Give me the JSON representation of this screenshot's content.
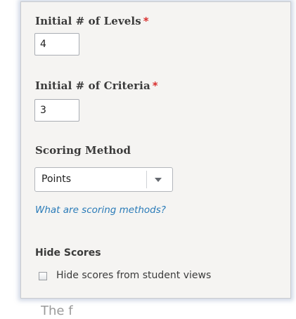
{
  "form": {
    "levels": {
      "label": "Initial # of Levels",
      "required_mark": "*",
      "value": "4"
    },
    "criteria": {
      "label": "Initial # of Criteria",
      "required_mark": "*",
      "value": "3"
    },
    "scoring": {
      "label": "Scoring Method",
      "selected": "Points",
      "help_link": "What are scoring methods?"
    },
    "hide_scores": {
      "label": "Hide Scores",
      "checkbox_label": "Hide scores from student views",
      "checked": false
    }
  },
  "below_panel": {
    "partial_text": "The f"
  },
  "icons": {
    "dropdown": "chevron-down-icon",
    "required": "asterisk-icon"
  },
  "colors": {
    "required": "#d9302f",
    "link": "#2a7bb8",
    "panel_bg": "#f5f4f2"
  }
}
